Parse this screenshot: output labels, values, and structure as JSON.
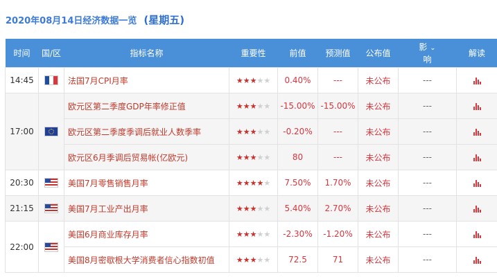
{
  "header": {
    "date": "2020年08月14日经济数据一览",
    "weekday": "(星期五)"
  },
  "columns": {
    "time": "时间",
    "country": "国/区",
    "indicator": "指标名称",
    "importance": "重要性",
    "previous": "前值",
    "forecast": "预测值",
    "actual": "公布值",
    "impact_top": "影",
    "impact_bottom": "响",
    "interpret": "解读"
  },
  "groups": [
    {
      "time": "14:45",
      "flag": "flag-fr",
      "icon": "france-flag-icon",
      "rows": [
        {
          "indicator": "法国7月CPI月率",
          "stars": 3,
          "previous": "0.40%",
          "forecast": "---",
          "actual": "未公布",
          "impact": "---"
        }
      ]
    },
    {
      "time": "17:00",
      "flag": "flag-eu",
      "icon": "eu-flag-icon",
      "rows": [
        {
          "indicator": "欧元区第二季度GDP年率修正值",
          "stars": 3,
          "previous": "-15.00%",
          "forecast": "-15.00%",
          "actual": "未公布",
          "impact": "---"
        },
        {
          "indicator": "欧元区第二季度季调后就业人数季率",
          "stars": 3,
          "previous": "-0.20%",
          "forecast": "---",
          "actual": "未公布",
          "impact": "---"
        },
        {
          "indicator": "欧元区6月季调后贸易帐(亿欧元)",
          "stars": 3,
          "previous": "80",
          "forecast": "---",
          "actual": "未公布",
          "impact": "---"
        }
      ]
    },
    {
      "time": "20:30",
      "flag": "flag-us",
      "icon": "us-flag-icon",
      "rows": [
        {
          "indicator": "美国7月零售销售月率",
          "stars": 4,
          "previous": "7.50%",
          "forecast": "1.70%",
          "actual": "未公布",
          "impact": "---"
        }
      ]
    },
    {
      "time": "21:15",
      "flag": "flag-us",
      "icon": "us-flag-icon",
      "rows": [
        {
          "indicator": "美国7月工业产出月率",
          "stars": 3,
          "previous": "5.40%",
          "forecast": "2.70%",
          "actual": "未公布",
          "impact": "---"
        }
      ]
    },
    {
      "time": "22:00",
      "flag": "flag-us",
      "icon": "us-flag-icon",
      "rows": [
        {
          "indicator": "美国6月商业库存月率",
          "stars": 3,
          "previous": "-2.30%",
          "forecast": "-1.20%",
          "actual": "未公布",
          "impact": "---"
        },
        {
          "indicator": "美国8月密歇根大学消费者信心指数初值",
          "stars": 3,
          "previous": "72.5",
          "forecast": "71",
          "actual": "未公布",
          "impact": "---"
        }
      ]
    }
  ]
}
